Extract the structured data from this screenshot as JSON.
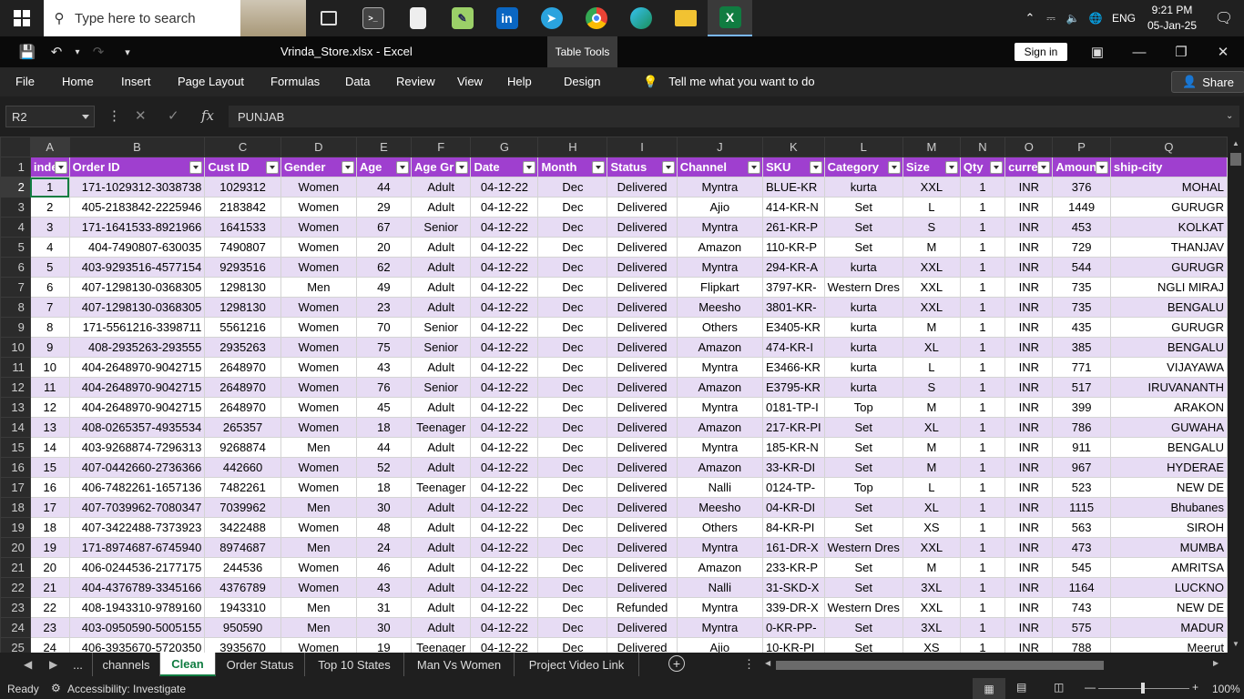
{
  "taskbar": {
    "search_placeholder": "Type here to search",
    "apps": [
      {
        "name": "task-view",
        "icon": "task-view-icon"
      },
      {
        "name": "terminal",
        "icon": "terminal-icon"
      },
      {
        "name": "notepad",
        "icon": "file-icon"
      },
      {
        "name": "notepad-plus",
        "icon": "edit-icon"
      },
      {
        "name": "linkedin",
        "icon": "linkedin-icon",
        "label": "in"
      },
      {
        "name": "telegram",
        "icon": "telegram-icon"
      },
      {
        "name": "chrome",
        "icon": "chrome-icon"
      },
      {
        "name": "edge",
        "icon": "edge-icon"
      },
      {
        "name": "file-explorer",
        "icon": "folder-icon"
      },
      {
        "name": "excel",
        "icon": "excel-icon",
        "label": "X"
      }
    ],
    "language": "ENG",
    "time": "9:21 PM",
    "date": "05-Jan-25"
  },
  "window": {
    "title": "Vrinda_Store.xlsx  -  Excel",
    "table_tools": "Table Tools",
    "sign_in": "Sign in"
  },
  "menu": {
    "items": [
      "File",
      "Home",
      "Insert",
      "Page Layout",
      "Formulas",
      "Data",
      "Review",
      "View",
      "Help",
      "Design"
    ],
    "tell_me": "Tell me what you want to do",
    "share": "Share"
  },
  "formula_bar": {
    "name_box": "R2",
    "fx": "fx",
    "value": "PUNJAB"
  },
  "columns": [
    "A",
    "B",
    "C",
    "D",
    "E",
    "F",
    "G",
    "H",
    "I",
    "J",
    "K",
    "L",
    "M",
    "N",
    "O",
    "P",
    "Q"
  ],
  "headers": [
    "inde",
    "Order ID",
    "Cust ID",
    "Gender",
    "Age",
    "Age Gr",
    "Date",
    "Month",
    "Status",
    "Channel",
    "SKU",
    "Category",
    "Size",
    "Qty",
    "curre",
    "Amoun",
    "ship-city"
  ],
  "rows": [
    [
      "1",
      "171-1029312-3038738",
      "1029312",
      "Women",
      "44",
      "Adult",
      "04-12-22",
      "Dec",
      "Delivered",
      "Myntra",
      "BLUE-KR",
      "kurta",
      "XXL",
      "1",
      "INR",
      "376",
      "MOHAL"
    ],
    [
      "2",
      "405-2183842-2225946",
      "2183842",
      "Women",
      "29",
      "Adult",
      "04-12-22",
      "Dec",
      "Delivered",
      "Ajio",
      "414-KR-N",
      "Set",
      "L",
      "1",
      "INR",
      "1449",
      "GURUGR"
    ],
    [
      "3",
      "171-1641533-8921966",
      "1641533",
      "Women",
      "67",
      "Senior",
      "04-12-22",
      "Dec",
      "Delivered",
      "Myntra",
      "261-KR-P",
      "Set",
      "S",
      "1",
      "INR",
      "453",
      "KOLKAT"
    ],
    [
      "4",
      "404-7490807-630035",
      "7490807",
      "Women",
      "20",
      "Adult",
      "04-12-22",
      "Dec",
      "Delivered",
      "Amazon",
      "110-KR-P",
      "Set",
      "M",
      "1",
      "INR",
      "729",
      "THANJAV"
    ],
    [
      "5",
      "403-9293516-4577154",
      "9293516",
      "Women",
      "62",
      "Adult",
      "04-12-22",
      "Dec",
      "Delivered",
      "Myntra",
      "294-KR-A",
      "kurta",
      "XXL",
      "1",
      "INR",
      "544",
      "GURUGR"
    ],
    [
      "6",
      "407-1298130-0368305",
      "1298130",
      "Men",
      "49",
      "Adult",
      "04-12-22",
      "Dec",
      "Delivered",
      "Flipkart",
      "3797-KR-",
      "Western Dres",
      "XXL",
      "1",
      "INR",
      "735",
      "NGLI  MIRAJ"
    ],
    [
      "7",
      "407-1298130-0368305",
      "1298130",
      "Women",
      "23",
      "Adult",
      "04-12-22",
      "Dec",
      "Delivered",
      "Meesho",
      "3801-KR-",
      "kurta",
      "XXL",
      "1",
      "INR",
      "735",
      "BENGALU"
    ],
    [
      "8",
      "171-5561216-3398711",
      "5561216",
      "Women",
      "70",
      "Senior",
      "04-12-22",
      "Dec",
      "Delivered",
      "Others",
      "E3405-KR",
      "kurta",
      "M",
      "1",
      "INR",
      "435",
      "GURUGR"
    ],
    [
      "9",
      "408-2935263-293555",
      "2935263",
      "Women",
      "75",
      "Senior",
      "04-12-22",
      "Dec",
      "Delivered",
      "Amazon",
      "474-KR-I",
      "kurta",
      "XL",
      "1",
      "INR",
      "385",
      "BENGALU"
    ],
    [
      "10",
      "404-2648970-9042715",
      "2648970",
      "Women",
      "43",
      "Adult",
      "04-12-22",
      "Dec",
      "Delivered",
      "Myntra",
      "E3466-KR",
      "kurta",
      "L",
      "1",
      "INR",
      "771",
      "VIJAYAWA"
    ],
    [
      "11",
      "404-2648970-9042715",
      "2648970",
      "Women",
      "76",
      "Senior",
      "04-12-22",
      "Dec",
      "Delivered",
      "Amazon",
      "E3795-KR",
      "kurta",
      "S",
      "1",
      "INR",
      "517",
      "IRUVANANTH"
    ],
    [
      "12",
      "404-2648970-9042715",
      "2648970",
      "Women",
      "45",
      "Adult",
      "04-12-22",
      "Dec",
      "Delivered",
      "Myntra",
      "0181-TP-I",
      "Top",
      "M",
      "1",
      "INR",
      "399",
      "ARAKON"
    ],
    [
      "13",
      "408-0265357-4935534",
      "265357",
      "Women",
      "18",
      "Teenager",
      "04-12-22",
      "Dec",
      "Delivered",
      "Amazon",
      "217-KR-PI",
      "Set",
      "XL",
      "1",
      "INR",
      "786",
      "GUWAHA"
    ],
    [
      "14",
      "403-9268874-7296313",
      "9268874",
      "Men",
      "44",
      "Adult",
      "04-12-22",
      "Dec",
      "Delivered",
      "Myntra",
      "185-KR-N",
      "Set",
      "M",
      "1",
      "INR",
      "911",
      "BENGALU"
    ],
    [
      "15",
      "407-0442660-2736366",
      "442660",
      "Women",
      "52",
      "Adult",
      "04-12-22",
      "Dec",
      "Delivered",
      "Amazon",
      "33-KR-DI",
      "Set",
      "M",
      "1",
      "INR",
      "967",
      "HYDERAE"
    ],
    [
      "16",
      "406-7482261-1657136",
      "7482261",
      "Women",
      "18",
      "Teenager",
      "04-12-22",
      "Dec",
      "Delivered",
      "Nalli",
      "0124-TP-",
      "Top",
      "L",
      "1",
      "INR",
      "523",
      "NEW  DE"
    ],
    [
      "17",
      "407-7039962-7080347",
      "7039962",
      "Men",
      "30",
      "Adult",
      "04-12-22",
      "Dec",
      "Delivered",
      "Meesho",
      "04-KR-DI",
      "Set",
      "XL",
      "1",
      "INR",
      "1115",
      "Bhubanes"
    ],
    [
      "18",
      "407-3422488-7373923",
      "3422488",
      "Women",
      "48",
      "Adult",
      "04-12-22",
      "Dec",
      "Delivered",
      "Others",
      "84-KR-PI",
      "Set",
      "XS",
      "1",
      "INR",
      "563",
      "SIROH"
    ],
    [
      "19",
      "171-8974687-6745940",
      "8974687",
      "Men",
      "24",
      "Adult",
      "04-12-22",
      "Dec",
      "Delivered",
      "Myntra",
      "161-DR-X",
      "Western Dres",
      "XXL",
      "1",
      "INR",
      "473",
      "MUMBA"
    ],
    [
      "20",
      "406-0244536-2177175",
      "244536",
      "Women",
      "46",
      "Adult",
      "04-12-22",
      "Dec",
      "Delivered",
      "Amazon",
      "233-KR-P",
      "Set",
      "M",
      "1",
      "INR",
      "545",
      "AMRITSA"
    ],
    [
      "21",
      "404-4376789-3345166",
      "4376789",
      "Women",
      "43",
      "Adult",
      "04-12-22",
      "Dec",
      "Delivered",
      "Nalli",
      "31-SKD-X",
      "Set",
      "3XL",
      "1",
      "INR",
      "1164",
      "LUCKNO"
    ],
    [
      "22",
      "408-1943310-9789160",
      "1943310",
      "Men",
      "31",
      "Adult",
      "04-12-22",
      "Dec",
      "Refunded",
      "Myntra",
      "339-DR-X",
      "Western Dres",
      "XXL",
      "1",
      "INR",
      "743",
      "NEW  DE"
    ],
    [
      "23",
      "403-0950590-5005155",
      "950590",
      "Men",
      "30",
      "Adult",
      "04-12-22",
      "Dec",
      "Delivered",
      "Myntra",
      "0-KR-PP-",
      "Set",
      "3XL",
      "1",
      "INR",
      "575",
      "MADUR"
    ],
    [
      "24",
      "406-3935670-5720350",
      "3935670",
      "Women",
      "19",
      "Teenager",
      "04-12-22",
      "Dec",
      "Delivered",
      "Ajio",
      "10-KR-PI",
      "Set",
      "XS",
      "1",
      "INR",
      "788",
      "Meerut"
    ]
  ],
  "sheets": {
    "ellipsis": "...",
    "tabs": [
      "channels",
      "Clean",
      "Order Status",
      "Top 10 States",
      "Man Vs Women",
      "Project Video Link"
    ],
    "active": "Clean"
  },
  "status": {
    "ready": "Ready",
    "accessibility": "Accessibility: Investigate",
    "zoom": "100%"
  }
}
